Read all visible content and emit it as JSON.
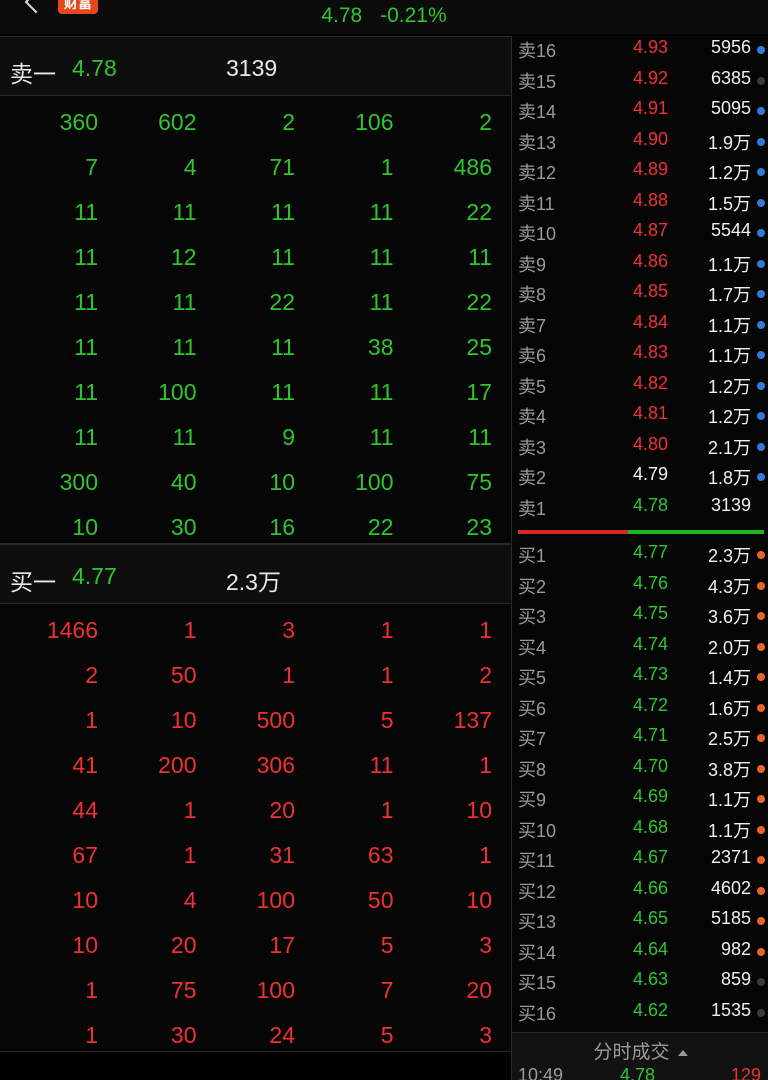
{
  "header": {
    "badge": "财富",
    "price": "4.78",
    "change": "-0.21%"
  },
  "sell_one": {
    "label": "卖一",
    "price": "4.78",
    "volume": "3139"
  },
  "sell_grid": [
    [
      "360",
      "602",
      "2",
      "106",
      "2"
    ],
    [
      "7",
      "4",
      "71",
      "1",
      "486"
    ],
    [
      "11",
      "11",
      "11",
      "11",
      "22"
    ],
    [
      "11",
      "12",
      "11",
      "11",
      "11"
    ],
    [
      "11",
      "11",
      "22",
      "11",
      "22"
    ],
    [
      "11",
      "11",
      "11",
      "38",
      "25"
    ],
    [
      "11",
      "100",
      "11",
      "11",
      "17"
    ],
    [
      "11",
      "11",
      "9",
      "11",
      "11"
    ],
    [
      "300",
      "40",
      "10",
      "100",
      "75"
    ],
    [
      "10",
      "30",
      "16",
      "22",
      "23"
    ]
  ],
  "buy_one": {
    "label": "买一",
    "price": "4.77",
    "volume": "2.3万"
  },
  "buy_grid": [
    [
      "1466",
      "1",
      "3",
      "1",
      "1"
    ],
    [
      "2",
      "50",
      "1",
      "1",
      "2"
    ],
    [
      "1",
      "10",
      "500",
      "5",
      "137"
    ],
    [
      "41",
      "200",
      "306",
      "11",
      "1"
    ],
    [
      "44",
      "1",
      "20",
      "1",
      "10"
    ],
    [
      "67",
      "1",
      "31",
      "63",
      "1"
    ],
    [
      "10",
      "4",
      "100",
      "50",
      "10"
    ],
    [
      "10",
      "20",
      "17",
      "5",
      "3"
    ],
    [
      "1",
      "75",
      "100",
      "7",
      "20"
    ],
    [
      "1",
      "30",
      "24",
      "5",
      "3"
    ]
  ],
  "asks": [
    {
      "label": "卖16",
      "price": "4.93",
      "vol": "5956",
      "color": "red",
      "dot": "blue"
    },
    {
      "label": "卖15",
      "price": "4.92",
      "vol": "6385",
      "color": "red",
      "dot": "grey"
    },
    {
      "label": "卖14",
      "price": "4.91",
      "vol": "5095",
      "color": "red",
      "dot": "blue"
    },
    {
      "label": "卖13",
      "price": "4.90",
      "vol": "1.9万",
      "color": "red",
      "dot": "blue"
    },
    {
      "label": "卖12",
      "price": "4.89",
      "vol": "1.2万",
      "color": "red",
      "dot": "blue"
    },
    {
      "label": "卖11",
      "price": "4.88",
      "vol": "1.5万",
      "color": "red",
      "dot": "blue"
    },
    {
      "label": "卖10",
      "price": "4.87",
      "vol": "5544",
      "color": "red",
      "dot": "blue"
    },
    {
      "label": "卖9",
      "price": "4.86",
      "vol": "1.1万",
      "color": "red",
      "dot": "blue"
    },
    {
      "label": "卖8",
      "price": "4.85",
      "vol": "1.7万",
      "color": "red",
      "dot": "blue"
    },
    {
      "label": "卖7",
      "price": "4.84",
      "vol": "1.1万",
      "color": "red",
      "dot": "blue"
    },
    {
      "label": "卖6",
      "price": "4.83",
      "vol": "1.1万",
      "color": "red",
      "dot": "blue"
    },
    {
      "label": "卖5",
      "price": "4.82",
      "vol": "1.2万",
      "color": "red",
      "dot": "blue"
    },
    {
      "label": "卖4",
      "price": "4.81",
      "vol": "1.2万",
      "color": "red",
      "dot": "blue"
    },
    {
      "label": "卖3",
      "price": "4.80",
      "vol": "2.1万",
      "color": "red",
      "dot": "blue"
    },
    {
      "label": "卖2",
      "price": "4.79",
      "vol": "1.8万",
      "color": "white",
      "dot": "blue"
    },
    {
      "label": "卖1",
      "price": "4.78",
      "vol": "3139",
      "color": "green",
      "dot": "none"
    }
  ],
  "bids": [
    {
      "label": "买1",
      "price": "4.77",
      "vol": "2.3万",
      "color": "green",
      "dot": "orange"
    },
    {
      "label": "买2",
      "price": "4.76",
      "vol": "4.3万",
      "color": "green",
      "dot": "orange"
    },
    {
      "label": "买3",
      "price": "4.75",
      "vol": "3.6万",
      "color": "green",
      "dot": "orange"
    },
    {
      "label": "买4",
      "price": "4.74",
      "vol": "2.0万",
      "color": "green",
      "dot": "orange"
    },
    {
      "label": "买5",
      "price": "4.73",
      "vol": "1.4万",
      "color": "green",
      "dot": "orange"
    },
    {
      "label": "买6",
      "price": "4.72",
      "vol": "1.6万",
      "color": "green",
      "dot": "orange"
    },
    {
      "label": "买7",
      "price": "4.71",
      "vol": "2.5万",
      "color": "green",
      "dot": "orange"
    },
    {
      "label": "买8",
      "price": "4.70",
      "vol": "3.8万",
      "color": "green",
      "dot": "orange"
    },
    {
      "label": "买9",
      "price": "4.69",
      "vol": "1.1万",
      "color": "green",
      "dot": "orange"
    },
    {
      "label": "买10",
      "price": "4.68",
      "vol": "1.1万",
      "color": "green",
      "dot": "orange"
    },
    {
      "label": "买11",
      "price": "4.67",
      "vol": "2371",
      "color": "green",
      "dot": "orange"
    },
    {
      "label": "买12",
      "price": "4.66",
      "vol": "4602",
      "color": "green",
      "dot": "orange"
    },
    {
      "label": "买13",
      "price": "4.65",
      "vol": "5185",
      "color": "green",
      "dot": "orange"
    },
    {
      "label": "买14",
      "price": "4.64",
      "vol": "982",
      "color": "green",
      "dot": "orange"
    },
    {
      "label": "买15",
      "price": "4.63",
      "vol": "859",
      "color": "green",
      "dot": "grey"
    },
    {
      "label": "买16",
      "price": "4.62",
      "vol": "1535",
      "color": "green",
      "dot": "grey"
    }
  ],
  "ticks": {
    "title": "分时成交",
    "first": {
      "time": "10:49",
      "price": "4.78",
      "vol": "129"
    }
  },
  "colors": {
    "up": "#ef3131",
    "down": "#2fc52f",
    "bg": "#000000",
    "accent": "#e8461b"
  }
}
